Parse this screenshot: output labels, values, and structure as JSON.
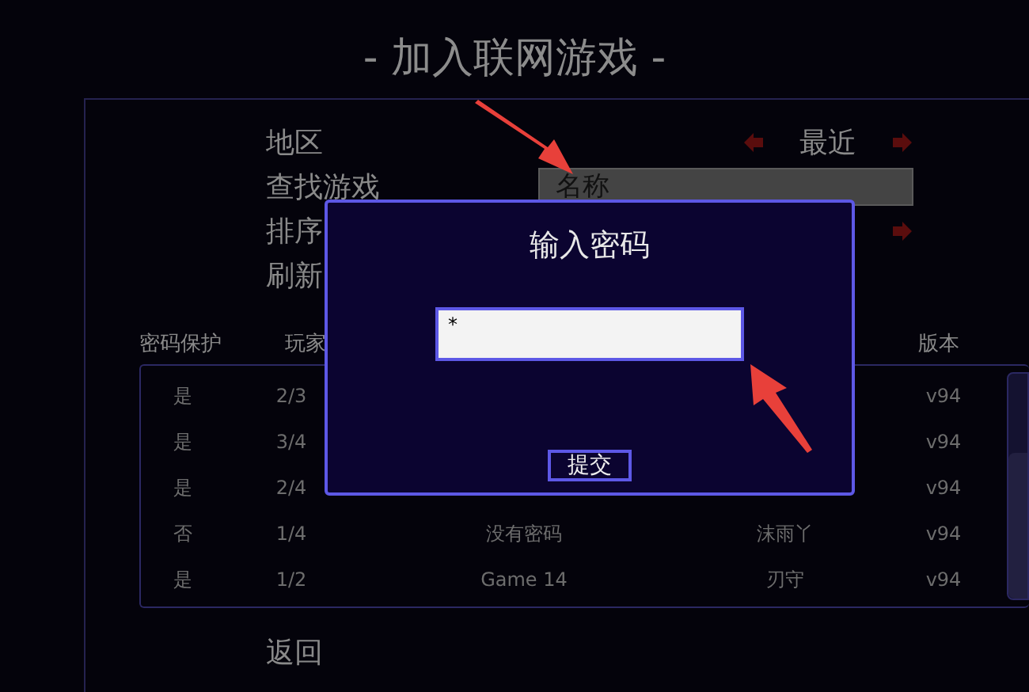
{
  "title": "- 加入联网游戏 -",
  "settings": [
    {
      "kind": "selector",
      "label": "地区",
      "value": "最近"
    },
    {
      "kind": "search",
      "label": "查找游戏",
      "placeholder": "名称"
    },
    {
      "kind": "selector",
      "label": "排序"
    },
    {
      "kind": "action",
      "label": "刷新"
    }
  ],
  "table": {
    "columns": [
      "密码保护",
      "玩家",
      null,
      null,
      "版本"
    ],
    "rows": [
      [
        "是",
        "2/3",
        null,
        null,
        "v94"
      ],
      [
        "是",
        "3/4",
        null,
        null,
        "v94"
      ],
      [
        "是",
        "2/4",
        null,
        null,
        "v94"
      ],
      [
        "否",
        "1/4",
        "没有密码",
        "沫雨丫",
        "v94"
      ],
      [
        "是",
        "1/2",
        "Game 14",
        "刃守",
        "v94"
      ]
    ]
  },
  "back": "返回",
  "dialog": {
    "title": "输入密码",
    "value": "*",
    "submit": "提交"
  }
}
